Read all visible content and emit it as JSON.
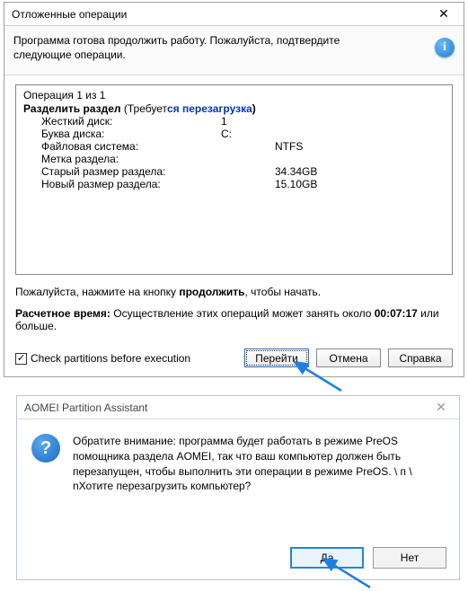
{
  "dialog1": {
    "title": "Отложенные операции",
    "header": "Программа готова продолжить работу. Пожалуйста, подтвердите следующие операции.",
    "op_count": "Операция 1 из 1",
    "op_name": "Разделить раздел",
    "op_req_prefix": "  (Требует",
    "op_req_link": "ся перезагрузка",
    "op_req_suffix": ")",
    "rows": [
      {
        "label": "Жесткий диск:",
        "value": "1"
      },
      {
        "label": "Буква диска:",
        "value": "C:"
      },
      {
        "label": "Файловая система:",
        "value": "NTFS"
      },
      {
        "label": "Метка раздела:",
        "value": ""
      },
      {
        "label": "Старый размер раздела:",
        "value": "34.34GB"
      },
      {
        "label": "Новый размер раздела:",
        "value": "15.10GB"
      }
    ],
    "msg_pre": "Пожалуйста, нажмите на кнопку ",
    "msg_bold": "продолжить",
    "msg_post": ", чтобы начать.",
    "est_label": "Расчетное время:",
    "est_text": " Осуществление этих операций может занять около ",
    "est_time": "00:07:17",
    "est_tail": " или больше.",
    "checkbox": "Check partitions before execution",
    "btn_go": "Перейти",
    "btn_cancel": "Отмена",
    "btn_help": "Справка"
  },
  "dialog2": {
    "title": "AOMEI Partition Assistant",
    "body": "Обратите внимание: программа будет работать в режиме PreOS помощника раздела AOMEI, так что ваш компьютер должен быть перезапущен, чтобы выполнить эти операции в режиме PreOS. \\ п \\ nХотите перезагрузить компьютер?",
    "btn_yes": "Да",
    "btn_no": "Нет"
  }
}
